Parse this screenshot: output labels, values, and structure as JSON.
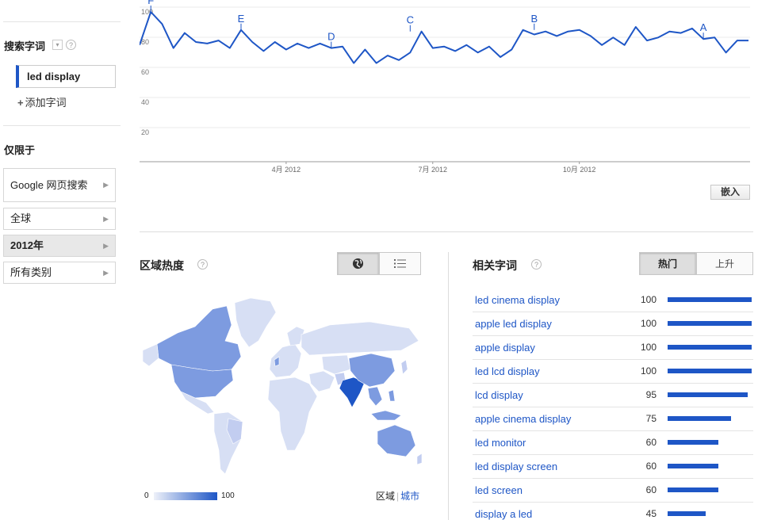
{
  "sidebar": {
    "search_terms_heading": "搜索字词",
    "term": "led display",
    "add_term_label": "添加字词",
    "limit_heading": "仅限于",
    "filters": [
      {
        "label": "Google 网页搜索",
        "selected": false
      },
      {
        "label": "全球",
        "selected": false
      },
      {
        "label": "2012年",
        "selected": true
      },
      {
        "label": "所有类别",
        "selected": false
      }
    ]
  },
  "chart_data": {
    "type": "line",
    "title": "",
    "xlabel": "",
    "ylabel": "",
    "ylim": [
      0,
      100
    ],
    "y_ticks": [
      "100",
      "80",
      "60",
      "40",
      "20"
    ],
    "x_ticks": [
      "4月 2012",
      "7月 2012",
      "10月 2012"
    ],
    "series": [
      {
        "values": [
          78,
          100,
          92,
          76,
          86,
          80,
          79,
          81,
          76,
          88,
          80,
          74,
          80,
          75,
          79,
          76,
          79,
          76,
          77,
          66,
          75,
          66,
          71,
          68,
          73,
          87,
          76,
          77,
          74,
          78,
          73,
          77,
          70,
          75,
          88,
          85,
          87,
          84,
          87,
          88,
          84,
          78,
          83,
          78,
          90,
          81,
          83,
          87,
          86,
          89,
          82,
          83,
          73,
          81,
          81
        ]
      }
    ],
    "annotations": [
      {
        "label": "F",
        "index": 1,
        "value": 100
      },
      {
        "label": "E",
        "index": 9,
        "value": 88
      },
      {
        "label": "D",
        "index": 17,
        "value": 76
      },
      {
        "label": "C",
        "index": 24,
        "value": 87
      },
      {
        "label": "B",
        "index": 35,
        "value": 88
      },
      {
        "label": "A",
        "index": 50,
        "value": 82
      }
    ],
    "line_color": "#1e56c6"
  },
  "embed_label": "嵌入",
  "region": {
    "title": "区域热度",
    "legend_min": "0",
    "legend_max": "100",
    "link_region": "区域",
    "link_city": "城市"
  },
  "related": {
    "title": "相关字词",
    "tab_top": "热门",
    "tab_rising": "上升",
    "items": [
      {
        "term": "led cinema display",
        "value": 100
      },
      {
        "term": "apple led display",
        "value": 100
      },
      {
        "term": "apple display",
        "value": 100
      },
      {
        "term": "led lcd display",
        "value": 100
      },
      {
        "term": "lcd display",
        "value": 95
      },
      {
        "term": "apple cinema display",
        "value": 75
      },
      {
        "term": "led monitor",
        "value": 60
      },
      {
        "term": "led display screen",
        "value": 60
      },
      {
        "term": "led screen",
        "value": 60
      },
      {
        "term": "display a led",
        "value": 45
      }
    ]
  },
  "colors": {
    "accent": "#1e56c6",
    "map_high": "#1e56c6",
    "map_mid": "#7d9be0",
    "map_low": "#d7dff4"
  }
}
